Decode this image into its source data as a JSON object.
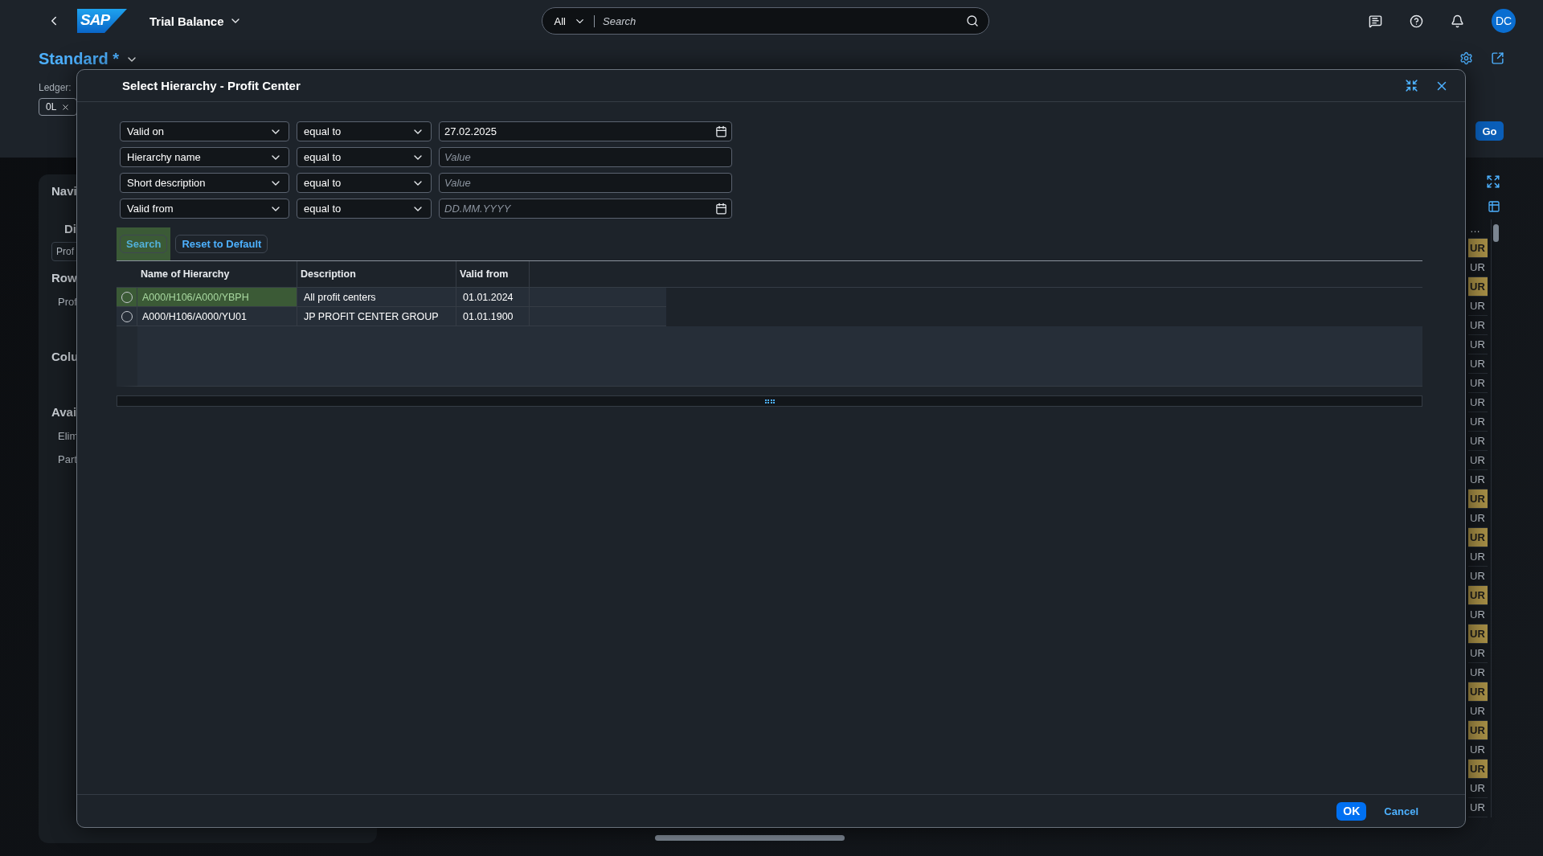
{
  "shell": {
    "logo": "SAP",
    "title": "Trial Balance",
    "search": {
      "scope": "All",
      "placeholder": "Search"
    },
    "avatar": "DC"
  },
  "header": {
    "variant": "Standard *",
    "ledger_label": "Ledger:",
    "ledger_token": "0L",
    "go": "Go"
  },
  "left_panel": {
    "items": [
      {
        "text": "Navi",
        "kind": "title"
      },
      {
        "text": "Di",
        "kind": "subheading"
      },
      {
        "text": "Prof",
        "kind": "field"
      },
      {
        "text": "Row",
        "kind": "heading"
      },
      {
        "text": "Prof",
        "kind": "item"
      },
      {
        "text": "Colu",
        "kind": "section"
      },
      {
        "text": "Avai",
        "kind": "section"
      },
      {
        "text": "Elim",
        "kind": "item"
      },
      {
        "text": "Part",
        "kind": "item"
      }
    ]
  },
  "right_table": {
    "header": "…",
    "cells": [
      {
        "text": "UR",
        "highlighted": true
      },
      {
        "text": "UR",
        "highlighted": false
      },
      {
        "text": "UR",
        "highlighted": true
      },
      {
        "text": "UR",
        "highlighted": false
      },
      {
        "text": "UR",
        "highlighted": false
      },
      {
        "text": "UR",
        "highlighted": false
      },
      {
        "text": "UR",
        "highlighted": false
      },
      {
        "text": "UR",
        "highlighted": false
      },
      {
        "text": "UR",
        "highlighted": false
      },
      {
        "text": "UR",
        "highlighted": false
      },
      {
        "text": "UR",
        "highlighted": false
      },
      {
        "text": "UR",
        "highlighted": false
      },
      {
        "text": "UR",
        "highlighted": false
      },
      {
        "text": "UR",
        "highlighted": true
      },
      {
        "text": "UR",
        "highlighted": false
      },
      {
        "text": "UR",
        "highlighted": true
      },
      {
        "text": "UR",
        "highlighted": false
      },
      {
        "text": "UR",
        "highlighted": false
      },
      {
        "text": "UR",
        "highlighted": true
      },
      {
        "text": "UR",
        "highlighted": false
      },
      {
        "text": "UR",
        "highlighted": true
      },
      {
        "text": "UR",
        "highlighted": false
      },
      {
        "text": "UR",
        "highlighted": false
      },
      {
        "text": "UR",
        "highlighted": true
      },
      {
        "text": "UR",
        "highlighted": false
      },
      {
        "text": "UR",
        "highlighted": true
      },
      {
        "text": "UR",
        "highlighted": false
      },
      {
        "text": "UR",
        "highlighted": true
      },
      {
        "text": "UR",
        "highlighted": false
      },
      {
        "text": "UR",
        "highlighted": false
      }
    ]
  },
  "dialog": {
    "title": "Select Hierarchy - Profit Center",
    "filters": [
      {
        "field": "Valid on",
        "operator": "equal to",
        "value": "27.02.2025",
        "kind": "date"
      },
      {
        "field": "Hierarchy name",
        "operator": "equal to",
        "placeholder": "Value",
        "kind": "text"
      },
      {
        "field": "Short description",
        "operator": "equal to",
        "placeholder": "Value",
        "kind": "text"
      },
      {
        "field": "Valid from",
        "operator": "equal to",
        "placeholder": "DD.MM.YYYY",
        "kind": "date"
      }
    ],
    "buttons": [
      {
        "label": "Search",
        "highlighted": true
      },
      {
        "label": "Reset to Default",
        "highlighted": false
      }
    ],
    "table": {
      "columns": [
        "Name of Hierarchy",
        "Description",
        "Valid from"
      ],
      "rows": [
        {
          "cells": [
            "A000/H106/A000/YBPH",
            "All profit centers",
            "01.01.2024"
          ],
          "selected": false,
          "highlighted": true
        },
        {
          "cells": [
            "A000/H106/A000/YU01",
            "JP PROFIT CENTER GROUP",
            "01.01.1900"
          ],
          "selected": false,
          "highlighted": false
        }
      ]
    },
    "footer": {
      "ok": "OK",
      "cancel": "Cancel"
    }
  }
}
